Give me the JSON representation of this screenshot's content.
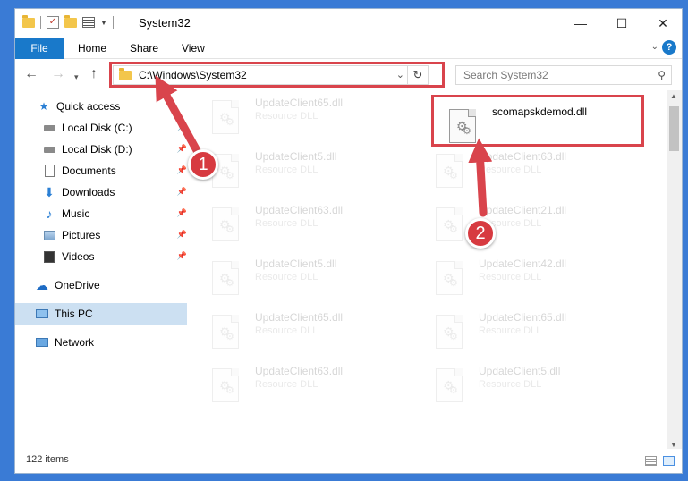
{
  "window": {
    "title": "System32",
    "controls": {
      "minimize": "—",
      "maximize": "☐",
      "close": "✕"
    }
  },
  "ribbon": {
    "tabs": [
      {
        "label": "File"
      },
      {
        "label": "Home"
      },
      {
        "label": "Share"
      },
      {
        "label": "View"
      }
    ],
    "help": "?"
  },
  "address_bar": {
    "path": "C:\\Windows\\System32"
  },
  "search": {
    "placeholder": "Search System32"
  },
  "sidebar": {
    "items": [
      {
        "label": "Quick access",
        "icon": "star-icon"
      },
      {
        "label": "Local Disk (C:)",
        "icon": "drive-icon",
        "pinned": true
      },
      {
        "label": "Local Disk (D:)",
        "icon": "drive-icon",
        "pinned": true
      },
      {
        "label": "Documents",
        "icon": "documents-icon",
        "pinned": true
      },
      {
        "label": "Downloads",
        "icon": "download-icon",
        "pinned": true
      },
      {
        "label": "Music",
        "icon": "music-icon",
        "pinned": true
      },
      {
        "label": "Pictures",
        "icon": "pictures-icon",
        "pinned": true
      },
      {
        "label": "Videos",
        "icon": "videos-icon",
        "pinned": true
      },
      {
        "label": "OneDrive",
        "icon": "cloud-icon"
      },
      {
        "label": "This PC",
        "icon": "computer-icon",
        "selected": true
      },
      {
        "label": "Network",
        "icon": "network-icon"
      }
    ]
  },
  "files": {
    "highlighted": {
      "name": "scomapskdemod.dll",
      "type": ""
    },
    "background": [
      {
        "name": "UpdateClient65.dll",
        "type": "Resource DLL"
      },
      {
        "name": "UpdateClient5.dll",
        "type": "Resource DLL"
      },
      {
        "name": "UpdateClient63.dll",
        "type": "Resource DLL"
      },
      {
        "name": "UpdateClient63.dll",
        "type": "Resource DLL"
      },
      {
        "name": "UpdateClient21.dll",
        "type": "Resource DLL"
      },
      {
        "name": "UpdateClient5.dll",
        "type": "Resource DLL"
      },
      {
        "name": "UpdateClient42.dll",
        "type": "Resource DLL"
      },
      {
        "name": "UpdateClient65.dll",
        "type": "Resource DLL"
      },
      {
        "name": "UpdateClient65.dll",
        "type": "Resource DLL"
      },
      {
        "name": "UpdateClient63.dll",
        "type": "Resource DLL"
      },
      {
        "name": "UpdateClient5.dll",
        "type": "Resource DLL"
      }
    ]
  },
  "status": {
    "item_count": "122 items"
  },
  "annotations": {
    "step1": "1",
    "step2": "2",
    "color": "#d9444c"
  }
}
